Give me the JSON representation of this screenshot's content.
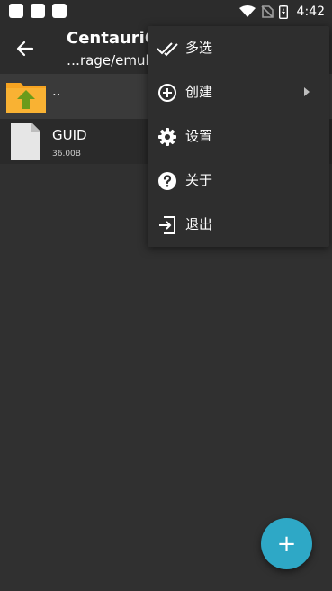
{
  "status_bar": {
    "time": "4:42"
  },
  "appbar": {
    "title": "CentauriO",
    "subtitle": "…rage/emula"
  },
  "files": [
    {
      "name": "..",
      "size": ""
    },
    {
      "name": "GUID",
      "size": "36.00B"
    }
  ],
  "menu": {
    "items": [
      {
        "label": "多选",
        "icon": "double-check-icon"
      },
      {
        "label": "创建",
        "icon": "add-circle-icon",
        "has_submenu": true
      },
      {
        "label": "设置",
        "icon": "gear-icon"
      },
      {
        "label": "关于",
        "icon": "help-icon"
      },
      {
        "label": "退出",
        "icon": "exit-icon"
      }
    ]
  },
  "fab": {
    "label": "+"
  },
  "colors": {
    "accent": "#2ea8c6",
    "folder": "#f7a421",
    "up_arrow": "#6b9b1b"
  }
}
